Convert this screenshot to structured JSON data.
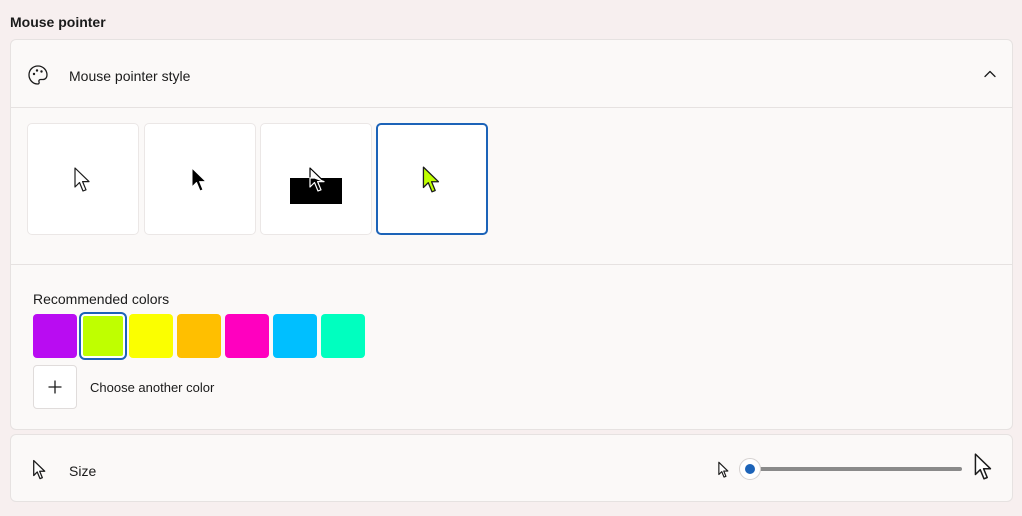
{
  "section": {
    "title": "Mouse pointer"
  },
  "pointer_style": {
    "label": "Mouse pointer style",
    "options": [
      {
        "name": "white"
      },
      {
        "name": "black"
      },
      {
        "name": "inverted"
      },
      {
        "name": "custom",
        "selected": true
      }
    ]
  },
  "colors": {
    "label": "Recommended colors",
    "swatches": [
      {
        "color": "#b90cf2"
      },
      {
        "color": "#bfff00",
        "selected": true
      },
      {
        "color": "#fbff00"
      },
      {
        "color": "#ffbf00"
      },
      {
        "color": "#ff00bf"
      },
      {
        "color": "#00bfff"
      },
      {
        "color": "#00ffbf"
      }
    ],
    "add_label": "Choose another color"
  },
  "size": {
    "label": "Size",
    "level": 0.0
  },
  "accent": "#1c63b8",
  "icons": {
    "header": "palette-icon",
    "collapse": "chevron-up-icon",
    "add": "plus-icon",
    "size": "cursor-icon"
  }
}
